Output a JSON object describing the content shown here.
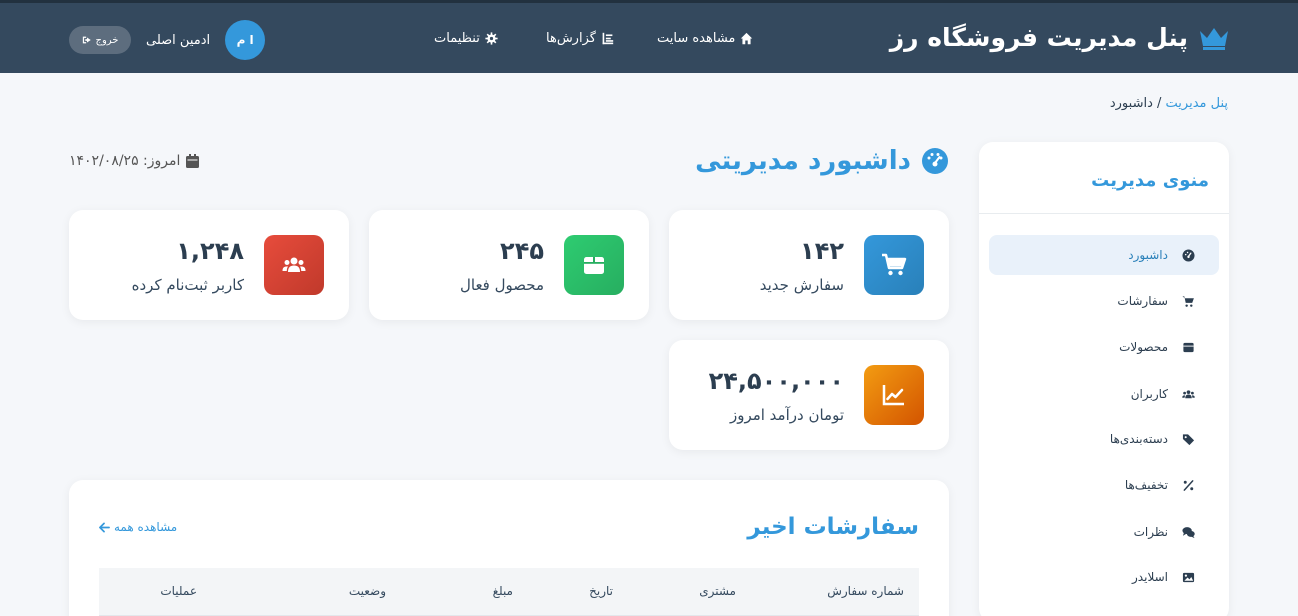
{
  "header": {
    "brand": "پنل مدیریت فروشگاه رز",
    "nav": {
      "view_site": "مشاهده سایت",
      "reports": "گزارش‌ها",
      "settings": "تنظیمات"
    },
    "user_name": "ادمین اصلی",
    "avatar_initials": "ا م",
    "logout": "خروج"
  },
  "breadcrumb": {
    "home": "پنل مدیریت",
    "separator": " / ",
    "current": "داشبورد"
  },
  "page": {
    "title": "داشبورد مدیریتی",
    "today_label": "امروز: ۱۴۰۲/۰۸/۲۵"
  },
  "stats": [
    {
      "value": "۱۴۲",
      "label": "سفارش جدید",
      "color": "#3498db",
      "icon": "cart-icon"
    },
    {
      "value": "۲۴۵",
      "label": "محصول فعال",
      "color": "#2ecc71",
      "icon": "box-icon"
    },
    {
      "value": "۱,۲۴۸",
      "label": "کاربر ثبت‌نام کرده",
      "color": "#e74c3c",
      "icon": "users-icon"
    },
    {
      "value": "۲۴,۵۰۰,۰۰۰",
      "label": "تومان درآمد امروز",
      "color": "#e67e22",
      "icon": "chart-line-icon"
    }
  ],
  "sidebar": {
    "title": "منوی مدیریت",
    "items": [
      {
        "label": "داشبورد",
        "icon": "gauge-icon"
      },
      {
        "label": "سفارشات",
        "icon": "cart-icon"
      },
      {
        "label": "محصولات",
        "icon": "box-icon"
      },
      {
        "label": "کاربران",
        "icon": "users-icon"
      },
      {
        "label": "دسته‌بندی‌ها",
        "icon": "tag-icon"
      },
      {
        "label": "تخفیف‌ها",
        "icon": "percent-icon"
      },
      {
        "label": "نظرات",
        "icon": "comments-icon"
      },
      {
        "label": "اسلایدر",
        "icon": "image-icon"
      }
    ]
  },
  "orders": {
    "title": "سفارشات اخیر",
    "view_all": "مشاهده همه",
    "columns": [
      "شماره سفارش",
      "مشتری",
      "تاریخ",
      "مبلغ",
      "وضعیت",
      "عملیات"
    ]
  },
  "colors": {
    "header_bg": "#34495e",
    "accent": "#3498db",
    "page_bg": "#f5f7fa"
  }
}
